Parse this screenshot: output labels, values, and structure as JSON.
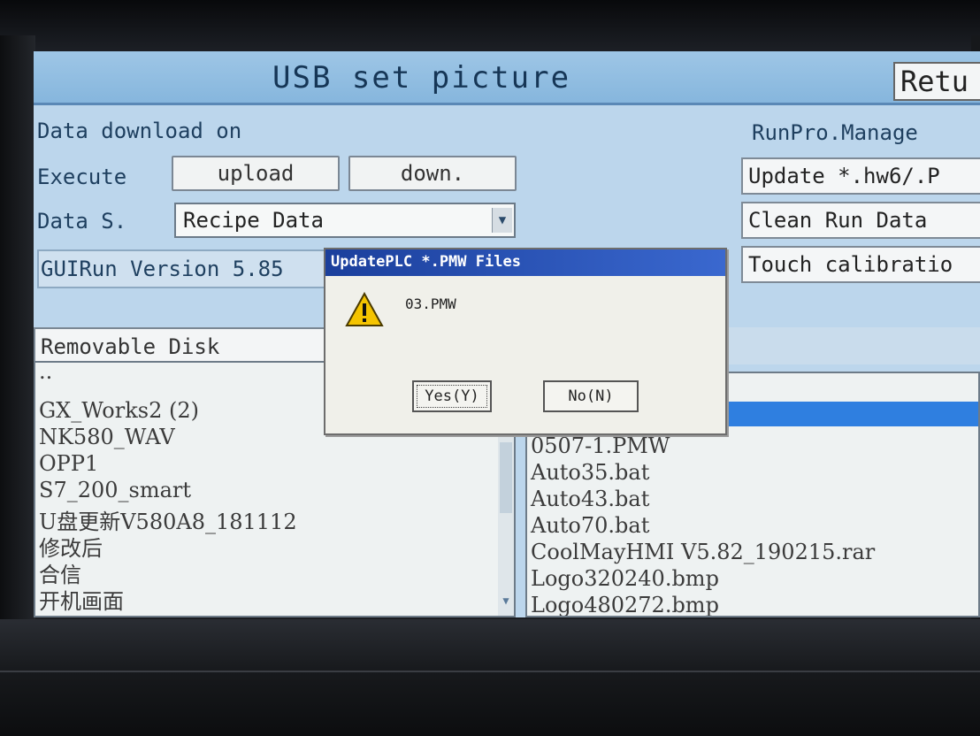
{
  "header": {
    "title": "USB set picture",
    "return_label": "Retu"
  },
  "data_download": {
    "heading": "Data download on",
    "execute_label": "Execute",
    "upload_label": "upload",
    "down_label": "down.",
    "data_source_label": "Data S.",
    "data_source_value": "Recipe Data",
    "gui_version": "GUIRun Version 5.85"
  },
  "runpro": {
    "heading": "RunPro.Manage",
    "update_label": "Update *.hw6/.P",
    "clean_label": "Clean Run Data",
    "touch_label": "Touch calibratio"
  },
  "file_browser": {
    "drive": "Removable Disk",
    "folders": [
      "..",
      "GX_Works2 (2)",
      "NK580_WAV",
      "OPP1",
      "S7_200_smart",
      "U盘更新V580A8_181112",
      "修改后",
      "合信",
      "开机画面"
    ],
    "files": [
      "0507-1.PMW",
      "Auto35.bat",
      "Auto43.bat",
      "Auto70.bat",
      "CoolMayHMI V5.82_190215.rar",
      "Logo320240.bmp",
      "Logo480272.bmp"
    ]
  },
  "dialog": {
    "title": "UpdatePLC *.PMW Files",
    "message": "03.PMW",
    "yes_label": "Yes(Y)",
    "no_label": "No(N)"
  },
  "colors": {
    "screen_bg": "#bcd6ec",
    "title_bar": "#86b6dd",
    "dialog_title": "#1b3f9c",
    "selection": "#2f7fe0"
  }
}
